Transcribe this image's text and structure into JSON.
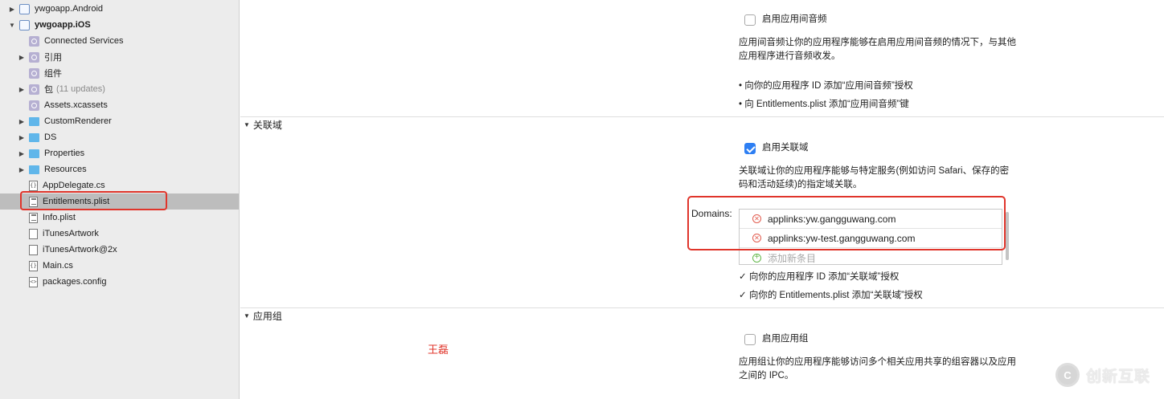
{
  "sidebar": {
    "items": [
      {
        "label": "ywgoapp.Android",
        "icon": "project-icon",
        "expander": "collapsed"
      },
      {
        "label": "ywgoapp.iOS",
        "icon": "project-icon",
        "expander": "expanded",
        "bold": true
      },
      {
        "label": "Connected Services",
        "icon": "virtual-folder-icon",
        "expander": "none"
      },
      {
        "label": "引用",
        "icon": "virtual-folder-icon",
        "expander": "collapsed"
      },
      {
        "label": "组件",
        "icon": "virtual-folder-icon",
        "expander": "none"
      },
      {
        "label": "包",
        "extra": "(11 updates)",
        "icon": "virtual-folder-icon",
        "expander": "collapsed"
      },
      {
        "label": "Assets.xcassets",
        "icon": "virtual-folder-icon",
        "expander": "none"
      },
      {
        "label": "CustomRenderer",
        "icon": "folder-icon",
        "expander": "collapsed"
      },
      {
        "label": "DS",
        "icon": "folder-icon",
        "expander": "collapsed"
      },
      {
        "label": "Properties",
        "icon": "folder-icon",
        "expander": "collapsed"
      },
      {
        "label": "Resources",
        "icon": "folder-icon",
        "expander": "collapsed"
      },
      {
        "label": "AppDelegate.cs",
        "icon": "code-file-icon",
        "expander": "none"
      },
      {
        "label": "Entitlements.plist",
        "icon": "plist-file-icon",
        "expander": "none",
        "selected": true
      },
      {
        "label": "Info.plist",
        "icon": "plist-file-icon",
        "expander": "none"
      },
      {
        "label": "iTunesArtwork",
        "icon": "file-icon",
        "expander": "none"
      },
      {
        "label": "iTunesArtwork@2x",
        "icon": "file-icon",
        "expander": "none"
      },
      {
        "label": "Main.cs",
        "icon": "code-file-icon",
        "expander": "none"
      },
      {
        "label": "packages.config",
        "icon": "config-file-icon",
        "expander": "none"
      }
    ]
  },
  "inter_app_audio": {
    "checkbox_label": "启用应用间音频",
    "checked": false,
    "description": "应用间音频让你的应用程序能够在启用应用间音频的情况下，与其他应用程序进行音频收发。",
    "bullets": [
      "• 向你的应用程序 ID 添加“应用间音频”授权",
      "• 向 Entitlements.plist 添加“应用间音频”键"
    ]
  },
  "associated_domains": {
    "section_title": "关联域",
    "checkbox_label": "启用关联域",
    "checked": true,
    "description": "关联域让你的应用程序能够与特定服务(例如访问 Safari、保存的密码和活动延续)的指定域关联。",
    "domains_label": "Domains:",
    "domains": [
      "applinks:yw.gangguwang.com",
      "applinks:yw-test.gangguwang.com"
    ],
    "add_placeholder": "添加新条目",
    "steps": [
      "✓ 向你的应用程序 ID 添加“关联域”授权",
      "✓ 向你的 Entitlements.plist 添加“关联域”授权"
    ]
  },
  "app_groups": {
    "section_title": "应用组",
    "checkbox_label": "启用应用组",
    "checked": false,
    "description": "应用组让你的应用程序能够访问多个相关应用共享的组容器以及应用之间的 IPC。"
  },
  "annotation": {
    "author": "王磊"
  },
  "watermark": {
    "text": "创新互联",
    "logo_glyph": "C"
  },
  "colors": {
    "selection": "#bdbdbd",
    "highlight_red": "#e0352b",
    "checkbox_blue": "#2e7ff3"
  }
}
